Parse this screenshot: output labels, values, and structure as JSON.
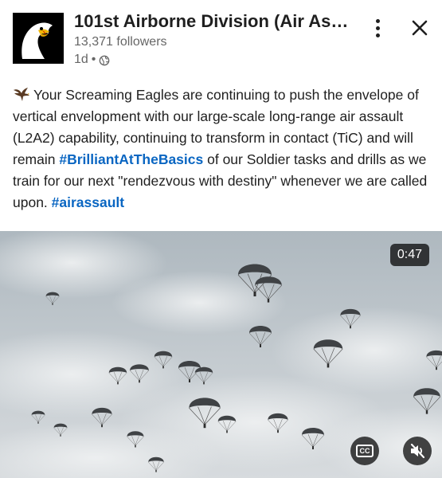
{
  "header": {
    "title": "101st Airborne Division (Air Assa...",
    "followers": "13,371 followers",
    "time": "1d",
    "separator": "•",
    "visibility_icon": "globe-icon",
    "menu_icon": "more-vertical-icon",
    "close_icon": "close-icon"
  },
  "post": {
    "emoji_icon": "eagle-icon",
    "text_part1": "Your Screaming Eagles are continuing to push the envelope of vertical envelopment with our large-scale long-range air assault (L2A2) capability, continuing to transform in contact (TiC) and will remain ",
    "hashtag1": "#BrilliantAtTheBasics",
    "text_part2": " of our Soldier tasks and drills as we train for our next \"rendezvous with destiny\" whenever we are called upon. ",
    "hashtag2": "#airassault"
  },
  "video": {
    "duration": "0:47",
    "cc_label": "CC",
    "cc_icon": "closed-captions-icon",
    "mute_icon": "volume-muted-icon"
  },
  "colors": {
    "hashtag": "#0a66c2",
    "text": "#1f1f1f",
    "secondary_text": "#666666",
    "overlay": "rgba(0,0,0,0.72)"
  }
}
